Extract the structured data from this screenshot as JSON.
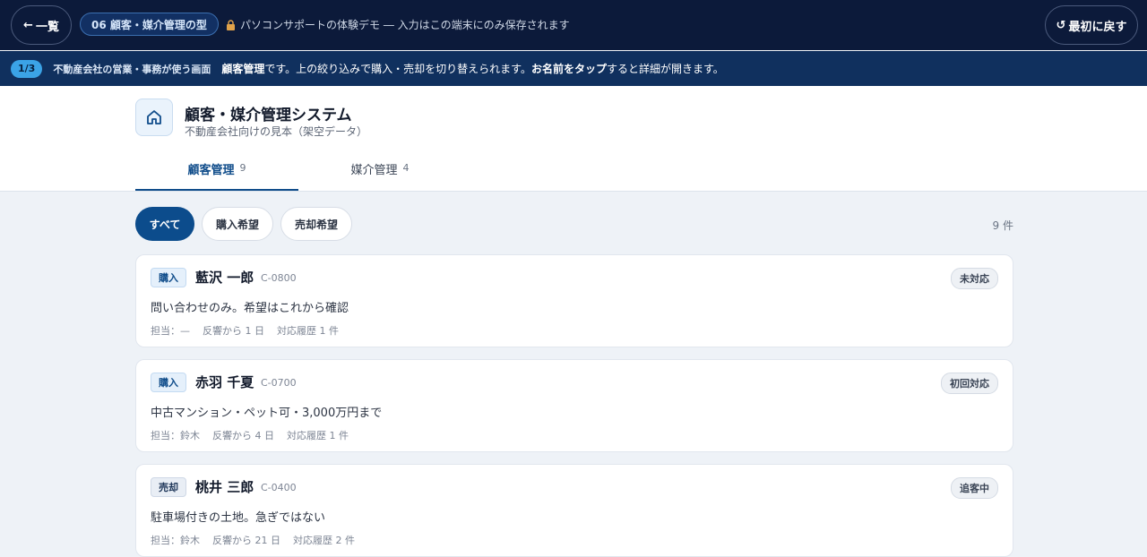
{
  "topbar": {
    "back_label": "一覧",
    "chapter_label": "06 顧客・媒介管理の型",
    "demo_note": "パソコンサポートの体験デモ ― 入力はこの端末にのみ保存されます",
    "reset_label": "最初に戻す"
  },
  "stepbar": {
    "step": "1/3",
    "context": "不動産会社の営業・事務が使う画面",
    "text_bold_1": "顧客管理",
    "text_1": "です。上の絞り込みで購入・売却を切り替えられます。",
    "text_bold_2": "お名前をタップ",
    "text_2": "すると詳細が開きます。"
  },
  "app": {
    "title": "顧客・媒介管理システム",
    "subtitle": "不動産会社向けの見本（架空データ）",
    "tabs": [
      {
        "label": "顧客管理",
        "count": "9"
      },
      {
        "label": "媒介管理",
        "count": "4"
      }
    ]
  },
  "filters": {
    "chips": [
      "すべて",
      "購入希望",
      "売却希望"
    ],
    "result_count": "9 件"
  },
  "customers": [
    {
      "type": "購入",
      "name": "藍沢 一郎",
      "id": "C-0800",
      "status": "未対応",
      "note": "問い合わせのみ。希望はこれから確認",
      "meta": [
        "担当：—",
        "反響から 1 日",
        "対応履歴 1 件"
      ]
    },
    {
      "type": "購入",
      "name": "赤羽 千夏",
      "id": "C-0700",
      "status": "初回対応",
      "note": "中古マンション・ペット可・3,000万円まで",
      "meta": [
        "担当：鈴木",
        "反響から 4 日",
        "対応履歴 1 件"
      ]
    },
    {
      "type": "売却",
      "name": "桃井 三郎",
      "id": "C-0400",
      "status": "追客中",
      "note": "駐車場付きの土地。急ぎではない",
      "meta": [
        "担当：鈴木",
        "反響から 21 日",
        "対応履歴 2 件"
      ]
    }
  ]
}
